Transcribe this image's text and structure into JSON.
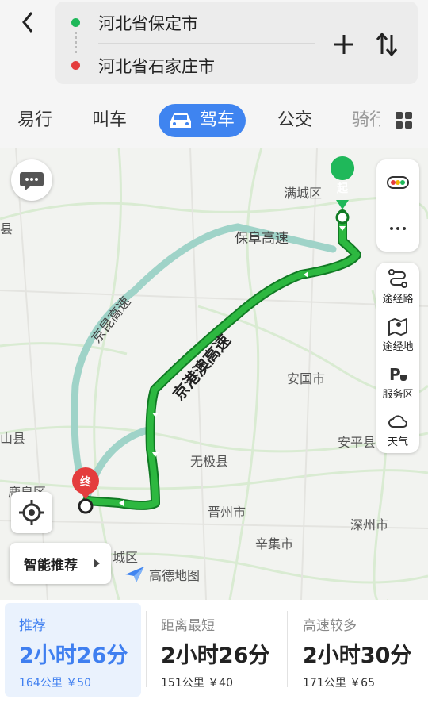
{
  "header": {
    "start": "河北省保定市",
    "end": "河北省石家庄市"
  },
  "tabs": [
    {
      "label": "易行"
    },
    {
      "label": "叫车"
    },
    {
      "label": "驾车",
      "active": true
    },
    {
      "label": "公交"
    },
    {
      "label": "骑行"
    }
  ],
  "map": {
    "labels": [
      "满城区",
      "保阜高速",
      "京昆高速",
      "京港澳高速",
      "安国市",
      "安平县",
      "无极县",
      "晋州市",
      "深州市",
      "辛集市",
      "山县",
      "鹿泉区",
      "县",
      "城区"
    ],
    "start_marker": "起",
    "end_marker": "终"
  },
  "side_panel": {
    "items": [
      {
        "icon": "traffic-light-icon",
        "label": ""
      },
      {
        "icon": "more-icon",
        "label": ""
      },
      {
        "icon": "waypoint-route-icon",
        "label": "途经路"
      },
      {
        "icon": "waypoint-place-icon",
        "label": "途经地"
      },
      {
        "icon": "service-area-icon",
        "label": "服务区"
      },
      {
        "icon": "weather-icon",
        "label": "天气"
      }
    ]
  },
  "smart_recommend": "智能推荐",
  "logo_text": "高德地图",
  "routes": [
    {
      "title": "推荐",
      "time": "2小时26分",
      "meta": "164公里 ￥50",
      "selected": true
    },
    {
      "title": "距离最短",
      "time": "2小时26分",
      "meta": "151公里 ￥40"
    },
    {
      "title": "高速较多",
      "time": "2小时30分",
      "meta": "171公里 ￥65"
    }
  ],
  "colors": {
    "accent": "#3f84f0",
    "route_main": "#1fa535",
    "route_alt": "#9fd3c8",
    "start": "#1fb85a",
    "end": "#e43d3d"
  }
}
